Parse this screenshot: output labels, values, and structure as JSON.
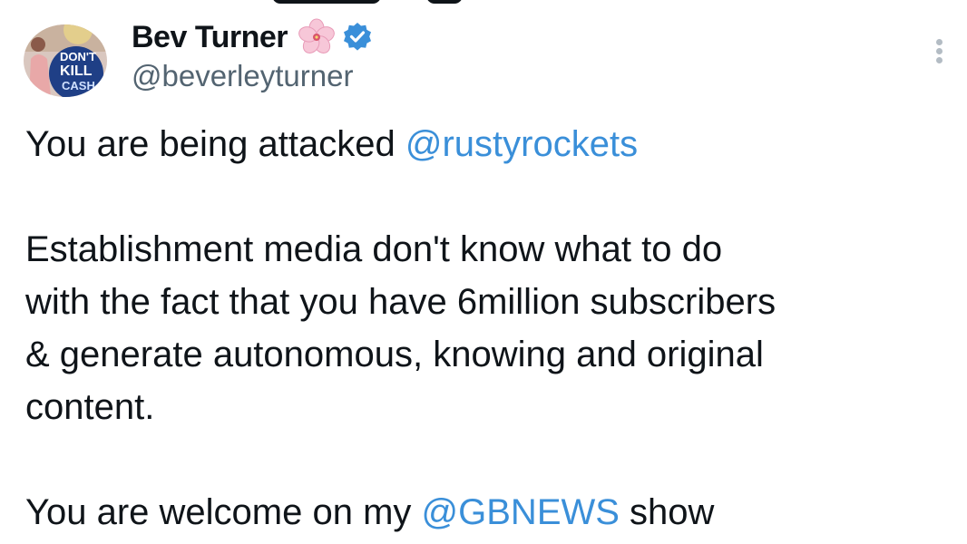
{
  "author": {
    "display_name": "Bev Turner",
    "handle": "@beverleyturner",
    "avatar_badge_text": [
      "DON'T",
      "KILL",
      "CASH"
    ],
    "name_emoji": "cherry-blossom-icon",
    "verified": true,
    "verified_color": "#3a8fd9"
  },
  "menu": {
    "more_icon": "more-vertical-icon"
  },
  "tweet": {
    "p1": {
      "text": "You are being attacked ",
      "mention": "@rustyrockets"
    },
    "p2": {
      "lines": [
        "Establishment media don't know what to do",
        "with the fact that you have 6million subscribers",
        "& generate autonomous, knowing and original",
        "content."
      ]
    },
    "p3": {
      "text_before": "You are welcome on my ",
      "mention": "@GBNEWS",
      "text_after": " show"
    }
  },
  "colors": {
    "text": "#0f1419",
    "secondary_text": "#536471",
    "link": "#3a8fd9",
    "background": "#ffffff"
  }
}
